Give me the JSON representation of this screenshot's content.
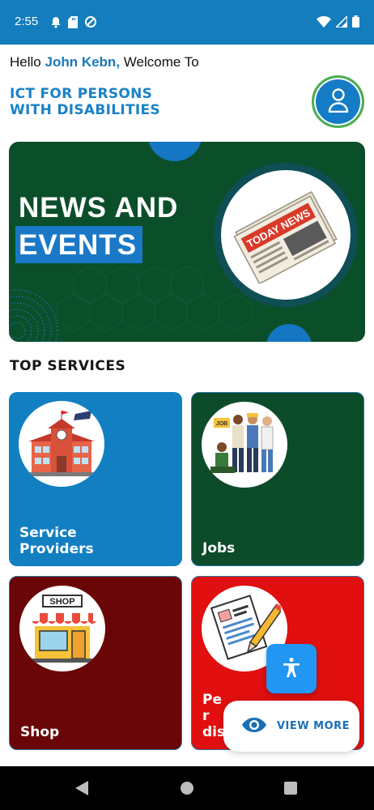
{
  "status_bar": {
    "time": "2:55",
    "icons_left": [
      "notification-bell-icon",
      "sd-card-icon",
      "data-saver-icon"
    ],
    "icons_right": [
      "wifi-icon",
      "signal-icon",
      "battery-icon"
    ]
  },
  "header": {
    "greeting_prefix": "Hello",
    "username": "John Kebn,",
    "greeting_suffix": "Welcome To",
    "app_title_line1": "ICT FOR PERSONS",
    "app_title_line2": "WITH DISABILITIES",
    "profile_icon": "person-icon"
  },
  "banner": {
    "title_line1": "NEWS AND",
    "title_line2": "EVENTS",
    "image_text": "TODAY NEWS"
  },
  "services": {
    "section_title": "TOP SERVICES",
    "cards": [
      {
        "label": "Service Providers",
        "icon": "school-building-icon",
        "color": "#127fc2"
      },
      {
        "label": "Jobs",
        "icon": "workers-icon",
        "color": "#0d4c2a",
        "image_text": "JOB"
      },
      {
        "label": "Shop",
        "icon": "shop-icon",
        "color": "#6a0607",
        "image_text": "SHOP"
      },
      {
        "label": "Per dis",
        "icon": "document-form-icon",
        "color": "#e10f0f"
      }
    ]
  },
  "accessibility": {
    "icon": "accessibility-icon"
  },
  "view_more": {
    "label": "VIEW MORE",
    "icon": "eye-icon"
  },
  "colors": {
    "primary": "#137dbe",
    "accent_green": "#4caf50",
    "banner_green": "#0b4f2a"
  }
}
